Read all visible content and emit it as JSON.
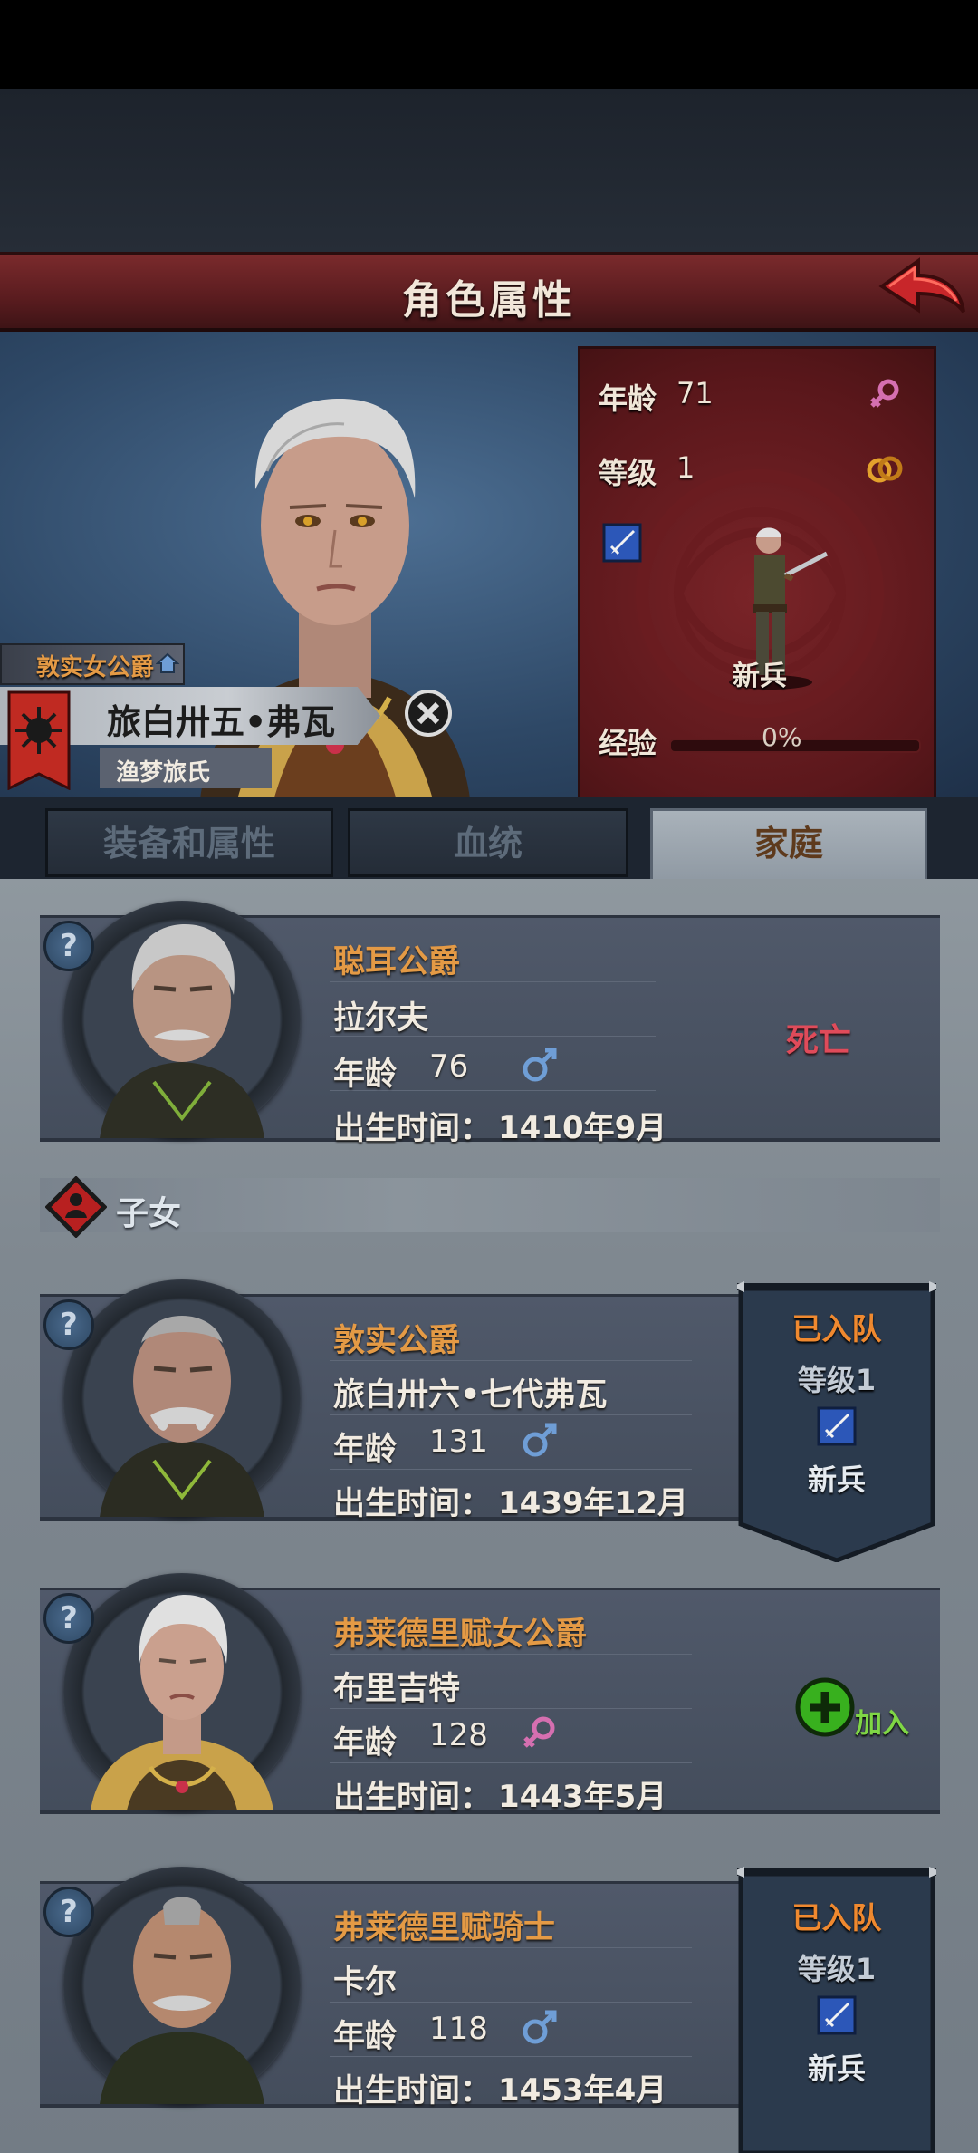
{
  "header": {
    "title": "角色属性"
  },
  "character": {
    "title_badge": "敦实女公爵",
    "name": "旅白卅五•弗瓦",
    "house": "渔梦旅氏",
    "age_label": "年龄",
    "age": "71",
    "level_label": "等级",
    "level": "1",
    "unit_label": "新兵",
    "exp_label": "经验",
    "exp_percent": "0%",
    "exp_fraction": 0
  },
  "tabs": [
    {
      "label": "装备和属性",
      "active": false
    },
    {
      "label": "血统",
      "active": false
    },
    {
      "label": "家庭",
      "active": true
    }
  ],
  "parent": {
    "title": "聪耳公爵",
    "name": "拉尔夫",
    "age_label": "年龄",
    "age": "76",
    "gender": "male",
    "birth_label": "出生时间：",
    "birth": "1410年9月",
    "status": "死亡"
  },
  "children_section": {
    "label": "子女"
  },
  "children": [
    {
      "title": "敦实公爵",
      "name": "旅白卅六•七代弗瓦",
      "age_label": "年龄",
      "age": "131",
      "gender": "male",
      "birth_label": "出生时间：",
      "birth": "1439年12月",
      "status": "已入队",
      "level_label": "等级1",
      "unit": "新兵"
    },
    {
      "title": "弗莱德里赋女公爵",
      "name": "布里吉特",
      "age_label": "年龄",
      "age": "128",
      "gender": "female",
      "birth_label": "出生时间：",
      "birth": "1443年5月",
      "action": "加入"
    },
    {
      "title": "弗莱德里赋骑士",
      "name": "卡尔",
      "age_label": "年龄",
      "age": "118",
      "gender": "male",
      "birth_label": "出生时间：",
      "birth": "1453年4月",
      "status": "已入队",
      "level_label": "等级1",
      "unit": "新兵"
    }
  ],
  "colors": {
    "title_orange": "#e49a45",
    "dead_red": "#e04b5a",
    "join_green": "#7fd645",
    "male_blue": "#6f9ed6",
    "female_pink": "#d56fb0"
  }
}
